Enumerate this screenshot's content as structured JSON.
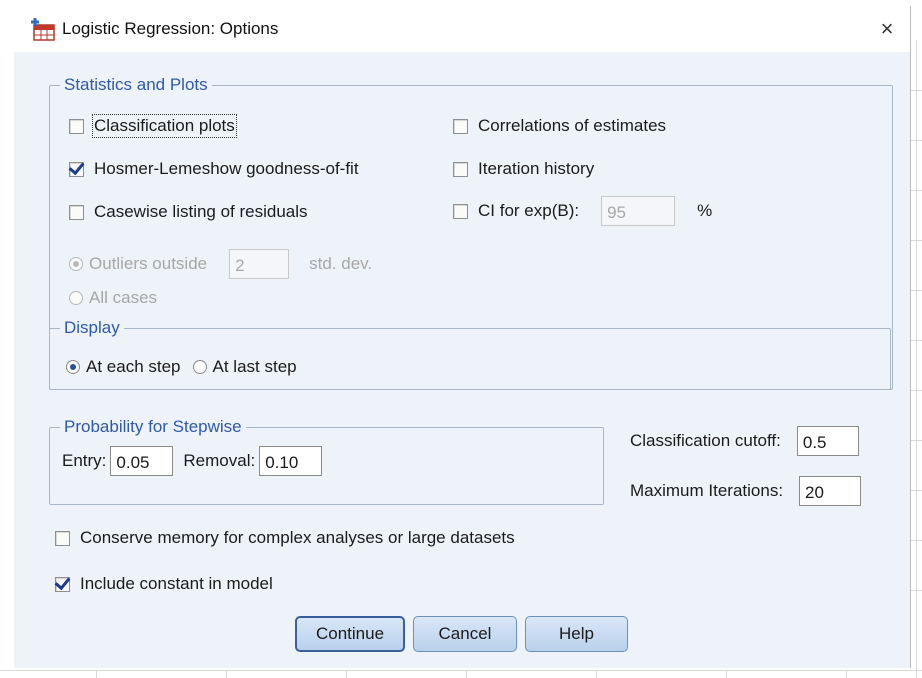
{
  "window": {
    "title": "Logistic Regression: Options",
    "close_glyph": "×",
    "app_icon": "spss-table-icon"
  },
  "stats_plots": {
    "legend": "Statistics and Plots",
    "classification_plots": {
      "label": "Classification plots",
      "checked": false
    },
    "hosmer_lemeshow": {
      "label": "Hosmer-Lemeshow goodness-of-fit",
      "checked": true
    },
    "casewise_listing": {
      "label": "Casewise listing of residuals",
      "checked": false
    },
    "outliers_outside": {
      "label": "Outliers outside",
      "value": "2",
      "unit": "std. dev.",
      "selected": true,
      "enabled": false
    },
    "all_cases": {
      "label": "All cases",
      "selected": false,
      "enabled": false
    },
    "correlations": {
      "label": "Correlations of estimates",
      "checked": false
    },
    "iteration_history": {
      "label": "Iteration history",
      "checked": false
    },
    "ci_exp_b": {
      "label": "CI for exp(B):",
      "value": "95",
      "unit": "%",
      "checked": false
    }
  },
  "display": {
    "legend": "Display",
    "at_each_step": {
      "label": "At each step",
      "selected": true
    },
    "at_last_step": {
      "label": "At last step",
      "selected": false
    }
  },
  "stepwise": {
    "legend": "Probability for Stepwise",
    "entry_label": "Entry:",
    "entry_value": "0.05",
    "removal_label": "Removal:",
    "removal_value": "0.10"
  },
  "classification_cutoff": {
    "label": "Classification cutoff:",
    "value": "0.5"
  },
  "maximum_iterations": {
    "label": "Maximum Iterations:",
    "value": "20"
  },
  "conserve_memory": {
    "label": "Conserve memory for complex analyses or large datasets",
    "checked": false
  },
  "include_constant": {
    "label": "Include constant in model",
    "checked": true
  },
  "buttons": {
    "continue": "Continue",
    "cancel": "Cancel",
    "help": "Help"
  },
  "colors": {
    "client_bg": "#eef3fa",
    "legend_text": "#2f5aa8",
    "button_face": "#c9dcf1",
    "check_mark": "#1b3c8f"
  }
}
